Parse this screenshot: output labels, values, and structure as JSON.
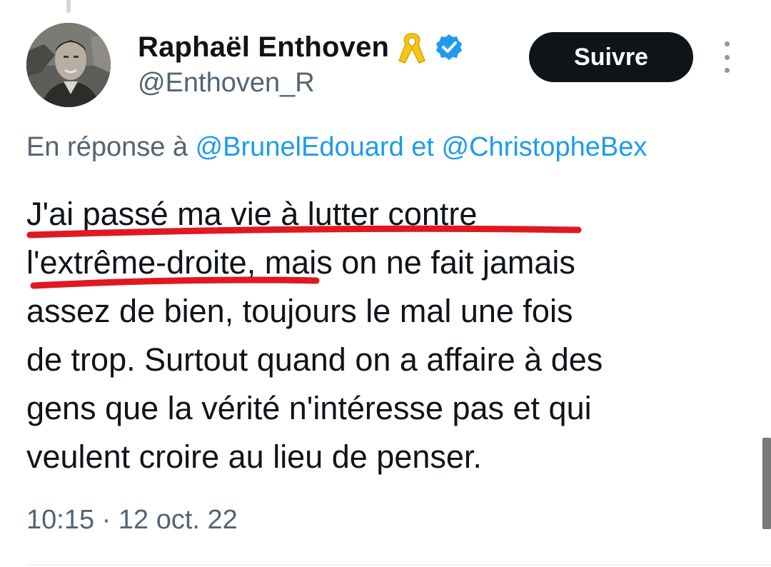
{
  "tweet": {
    "author": {
      "display_name": "Raphaël Enthoven",
      "handle": "@Enthoven_R",
      "badges": [
        "yellow-ribbon-icon",
        "verified-badge-icon"
      ]
    },
    "follow_label": "Suivre",
    "reply_context": {
      "prefix": "En réponse à ",
      "mention_1": "@BrunelEdouard",
      "connector": " et ",
      "mention_2": "@ChristopheBex"
    },
    "text_lines": [
      "J'ai passé ma vie à lutter contre",
      "l'extrême-droite, mais on ne fait jamais",
      "assez de bien, toujours le mal une fois",
      "de trop. Surtout quand on a affaire à des",
      "gens que la vérité n'intéresse pas et qui",
      "veulent croire au lieu de penser."
    ],
    "timestamp": "10:15 · 12 oct. 22"
  },
  "colors": {
    "text": "#0f1419",
    "secondary": "#536471",
    "link": "#1d9bf0",
    "verified": "#1d9bf0",
    "ribbon": "#f5c518",
    "annotation": "#e0191f"
  }
}
